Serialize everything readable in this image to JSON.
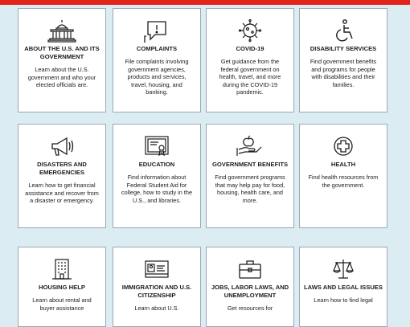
{
  "colors": {
    "accent_red": "#e2231a",
    "background": "#dcecf3",
    "card_border": "#9aa7b3"
  },
  "cards": [
    {
      "icon": "capitol-building-icon",
      "title": "ABOUT THE U.S. AND ITS GOVERNMENT",
      "desc": "Learn about the U.S. government and who your elected officials are."
    },
    {
      "icon": "speech-bubble-exclamation-icon",
      "title": "COMPLAINTS",
      "desc": "File complaints involving government agencies, products and services, travel, housing, and banking."
    },
    {
      "icon": "virus-icon",
      "title": "COVID-19",
      "desc": "Get guidance from the federal government on health, travel, and more during the COVID-19 pandemic."
    },
    {
      "icon": "accessibility-icon",
      "title": "DISABILITY SERVICES",
      "desc": "Find government benefits and programs for people with disabilities and their families."
    },
    {
      "icon": "megaphone-icon",
      "title": "DISASTERS AND EMERGENCIES",
      "desc": "Learn how to get financial assistance and recover from a disaster or emergency."
    },
    {
      "icon": "diploma-certificate-icon",
      "title": "EDUCATION",
      "desc": "Find information about Federal Student Aid for college, how to study in the U.S., and libraries."
    },
    {
      "icon": "hand-with-apple-icon",
      "title": "GOVERNMENT BENEFITS",
      "desc": "Find government programs that may help pay for food, housing, health care, and more."
    },
    {
      "icon": "health-cross-icon",
      "title": "HEALTH",
      "desc": "Find health resources from the government."
    },
    {
      "icon": "apartment-building-icon",
      "title": "HOUSING HELP",
      "desc": "Learn about rental and buyer assistance"
    },
    {
      "icon": "id-card-icon",
      "title": "IMMIGRATION AND U.S. CITIZENSHIP",
      "desc": "Learn about U.S."
    },
    {
      "icon": "briefcase-icon",
      "title": "JOBS, LABOR LAWS, AND UNEMPLOYMENT",
      "desc": "Get resources for"
    },
    {
      "icon": "scales-of-justice-icon",
      "title": "LAWS AND LEGAL ISSUES",
      "desc": "Learn how to find legal"
    }
  ]
}
